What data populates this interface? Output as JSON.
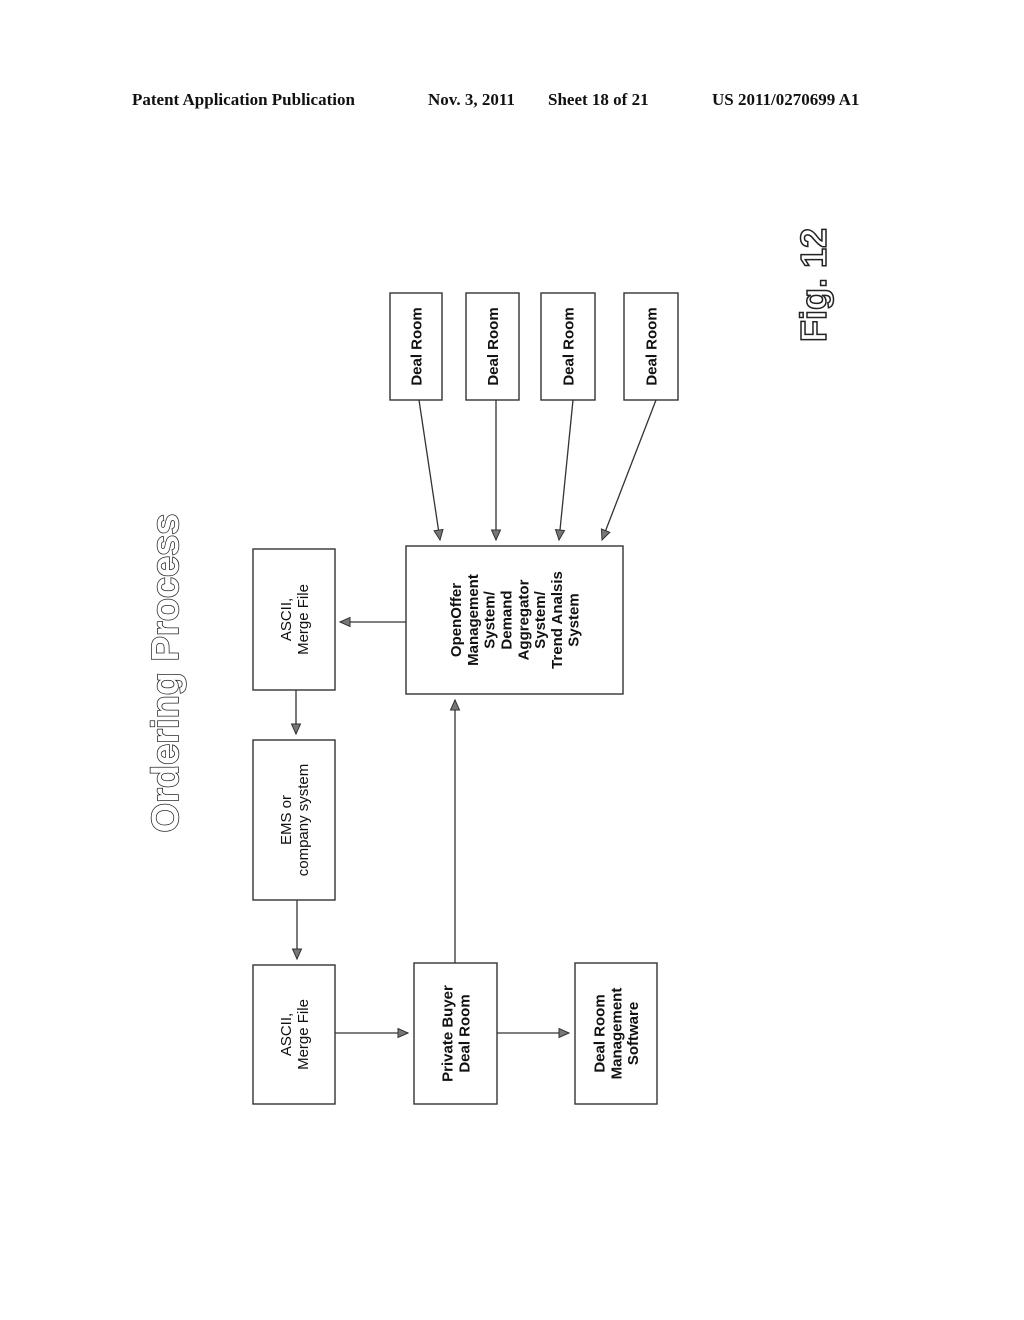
{
  "header": {
    "publication": "Patent Application Publication",
    "date": "Nov. 3, 2011",
    "sheet": "Sheet 18 of 21",
    "number": "US 2011/0270699 A1"
  },
  "diagram": {
    "title": "Ordering Process",
    "figure_label": "Fig. 12",
    "nodes": {
      "deal_room_1": {
        "lines": [
          "Deal Room"
        ]
      },
      "deal_room_2": {
        "lines": [
          "Deal Room"
        ]
      },
      "deal_room_3": {
        "lines": [
          "Deal Room"
        ]
      },
      "deal_room_4": {
        "lines": [
          "Deal Room"
        ]
      },
      "openoffer": {
        "lines": [
          "OpenOffer",
          "Management",
          "System/",
          "Demand",
          "Aggregator",
          "System/",
          "Trend Analsis",
          "System"
        ]
      },
      "ascii_top": {
        "lines": [
          "ASCII,",
          "Merge File"
        ]
      },
      "ems": {
        "lines": [
          "EMS or",
          "company system"
        ]
      },
      "ascii_bottom": {
        "lines": [
          "ASCII,",
          "Merge File"
        ]
      },
      "private_buyer": {
        "lines": [
          "Private Buyer",
          "Deal Room"
        ]
      },
      "deal_room_mgmt": {
        "lines": [
          "Deal Room",
          "Management",
          "Software"
        ]
      }
    },
    "edges": [
      {
        "from": "deal_room_1",
        "to": "openoffer"
      },
      {
        "from": "deal_room_2",
        "to": "openoffer"
      },
      {
        "from": "deal_room_3",
        "to": "openoffer"
      },
      {
        "from": "deal_room_4",
        "to": "openoffer"
      },
      {
        "from": "openoffer",
        "to": "ascii_top"
      },
      {
        "from": "ascii_top",
        "to": "ems"
      },
      {
        "from": "ems",
        "to": "ascii_bottom"
      },
      {
        "from": "ascii_bottom",
        "to": "private_buyer"
      },
      {
        "from": "private_buyer",
        "to": "openoffer"
      },
      {
        "from": "private_buyer",
        "to": "deal_room_mgmt"
      }
    ]
  }
}
